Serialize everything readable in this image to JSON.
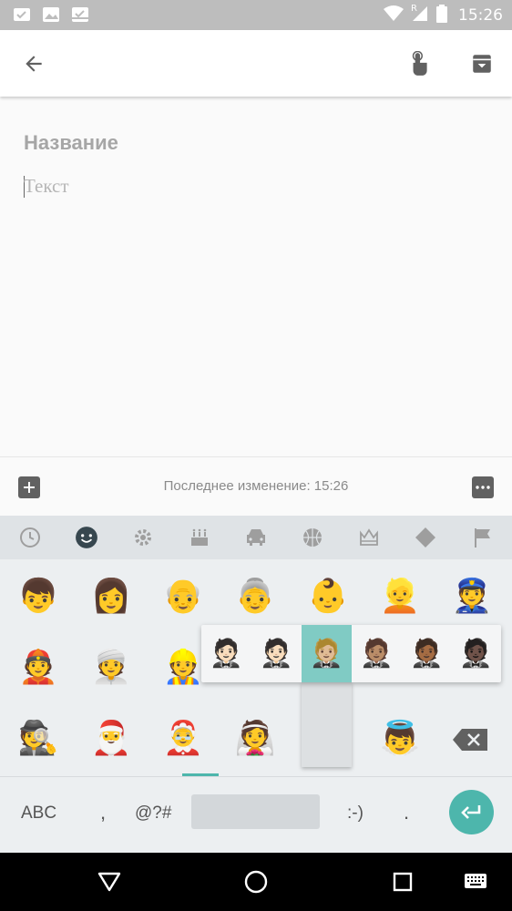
{
  "status_bar": {
    "time": "15:26",
    "roaming_indicator": "R",
    "left_icons": [
      "checklist-notification-icon",
      "gallery-notification-icon",
      "inbox-notification-icon"
    ],
    "right_icons": [
      "wifi-icon",
      "cellular-signal-icon",
      "battery-icon"
    ]
  },
  "app_bar": {
    "back_icon": "arrow-left-icon",
    "touch_icon": "hand-pointer-icon",
    "archive_icon": "archive-icon"
  },
  "editor": {
    "title_placeholder": "Название",
    "text_placeholder": "Текст"
  },
  "note_bar": {
    "last_modified": "Последнее изменение: 15:26",
    "add_icon": "plus-box-icon",
    "more_icon": "more-horizontal-icon"
  },
  "keyboard": {
    "categories": [
      "recent",
      "smileys",
      "objects",
      "celebration",
      "transport",
      "sports",
      "symbols",
      "diamond",
      "flags"
    ],
    "active_category": "smileys",
    "emoji_rows": [
      [
        "👦",
        "👩",
        "👴",
        "👵",
        "👶",
        "👱",
        "👮"
      ],
      [
        "👲",
        "👳",
        "👷",
        "",
        "",
        "",
        ""
      ],
      [
        "🕵",
        "🎅",
        "🤶",
        "👰",
        "",
        "👼",
        ""
      ]
    ],
    "skin_tone_variants": [
      "🤵🏻",
      "🤵🏻",
      "🤵🏼",
      "🤵🏽",
      "🤵🏾",
      "🤵🏿"
    ],
    "selected_tone_index": 2,
    "bottom_row": {
      "abc": "ABC",
      "comma": ",",
      "symbols": "@?#",
      "emoticon": ":-)",
      "period": "."
    },
    "accent_color": "#4db6ac"
  },
  "nav_bar": {
    "back_icon": "triangle-back-icon",
    "home_icon": "circle-home-icon",
    "recents_icon": "square-recents-icon",
    "keyboard_icon": "keyboard-switch-icon"
  }
}
